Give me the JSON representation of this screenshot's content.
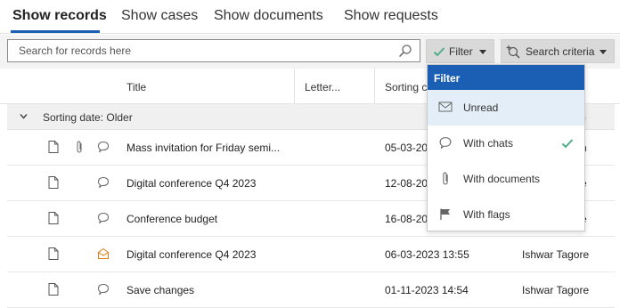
{
  "tabs": [
    {
      "label": "Show records",
      "active": true
    },
    {
      "label": "Show cases"
    },
    {
      "label": "Show documents"
    },
    {
      "label": "Show requests"
    }
  ],
  "toolbar": {
    "search_placeholder": "Search for records here",
    "filter_label": "Filter",
    "criteria_label": "Search criteria"
  },
  "columns": {
    "title": "Title",
    "letter": "Letter...",
    "sorting": "Sorting c"
  },
  "group": {
    "label": "Sorting date:  Older",
    "tail": ")"
  },
  "rows": [
    {
      "title": "Mass invitation for Friday semi...",
      "date": "05-03-20",
      "person": "n",
      "icons": [
        "document-icon",
        "attachment-icon",
        "chat-icon"
      ]
    },
    {
      "title": "Digital conference Q4 2023",
      "date": "12-08-20",
      "person": "e",
      "icons": [
        "document-icon",
        "chat-icon"
      ]
    },
    {
      "title": "Conference budget",
      "date": "16-08-20",
      "person": "e",
      "icons": [
        "document-icon",
        "chat-icon"
      ]
    },
    {
      "title": "Digital conference Q4 2023",
      "date": "06-03-2023 13:55",
      "person": "Ishwar Tagore",
      "icons": [
        "document-icon",
        "unread-mail-icon"
      ]
    },
    {
      "title": "Save changes",
      "date": "01-11-2023 14:54",
      "person": "Ishwar Tagore",
      "icons": [
        "document-icon",
        "chat-icon"
      ]
    }
  ],
  "dropdown": {
    "header": "Filter",
    "items": [
      {
        "label": "Unread",
        "icon": "envelope-icon",
        "highlighted": true,
        "checked": false
      },
      {
        "label": "With chats",
        "icon": "chat-icon",
        "highlighted": false,
        "checked": true
      },
      {
        "label": "With documents",
        "icon": "attachment-icon",
        "highlighted": false,
        "checked": false
      },
      {
        "label": "With flags",
        "icon": "flag-icon",
        "highlighted": false,
        "checked": false
      }
    ]
  },
  "colors": {
    "accent": "#1a5fb4",
    "check": "#4caf8a",
    "unread": "#e07a10"
  }
}
